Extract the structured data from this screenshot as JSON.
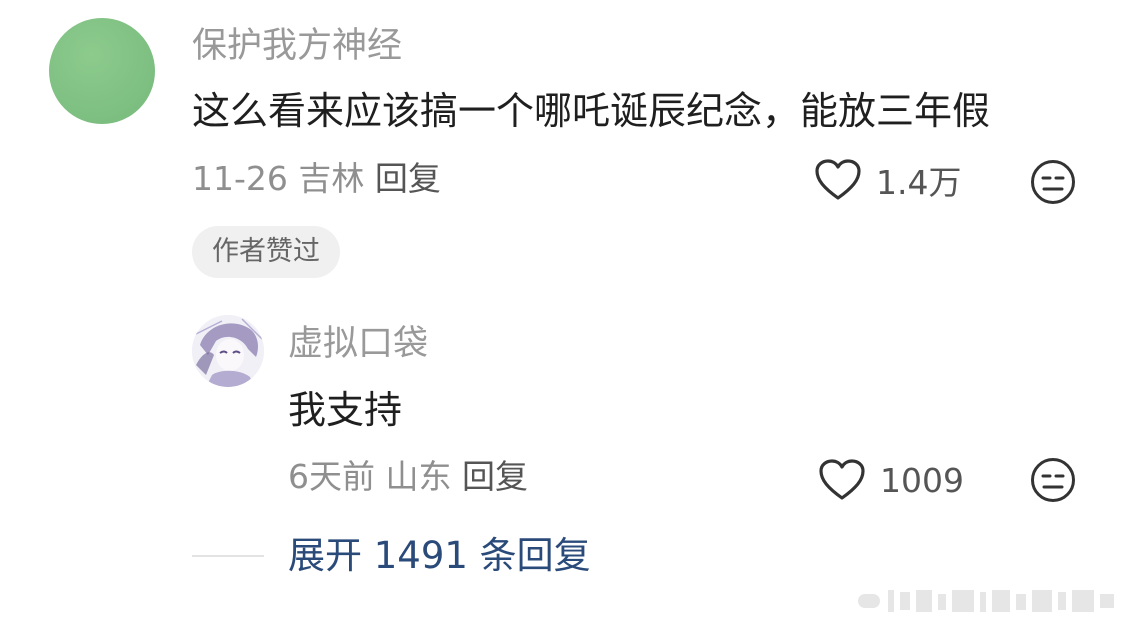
{
  "comment": {
    "username": "保护我方神经",
    "text": "这么看来应该搞一个哪吒诞辰纪念，能放三年假",
    "date": "11-26",
    "location": "吉林",
    "reply_label": "回复",
    "like_count": "1.4万",
    "badge": "作者赞过"
  },
  "reply": {
    "username": "虚拟口袋",
    "text": "我支持",
    "date": "6天前",
    "location": "山东",
    "reply_label": "回复",
    "like_count": "1009"
  },
  "expand_label": "展开 1491 条回复",
  "icons": {
    "like": "heart-outline-icon",
    "emoji": "neutral-face-icon"
  },
  "colors": {
    "avatar_main": "#7fc083",
    "expand_link": "#2a4a7a",
    "badge_bg": "#f0f0f0"
  }
}
